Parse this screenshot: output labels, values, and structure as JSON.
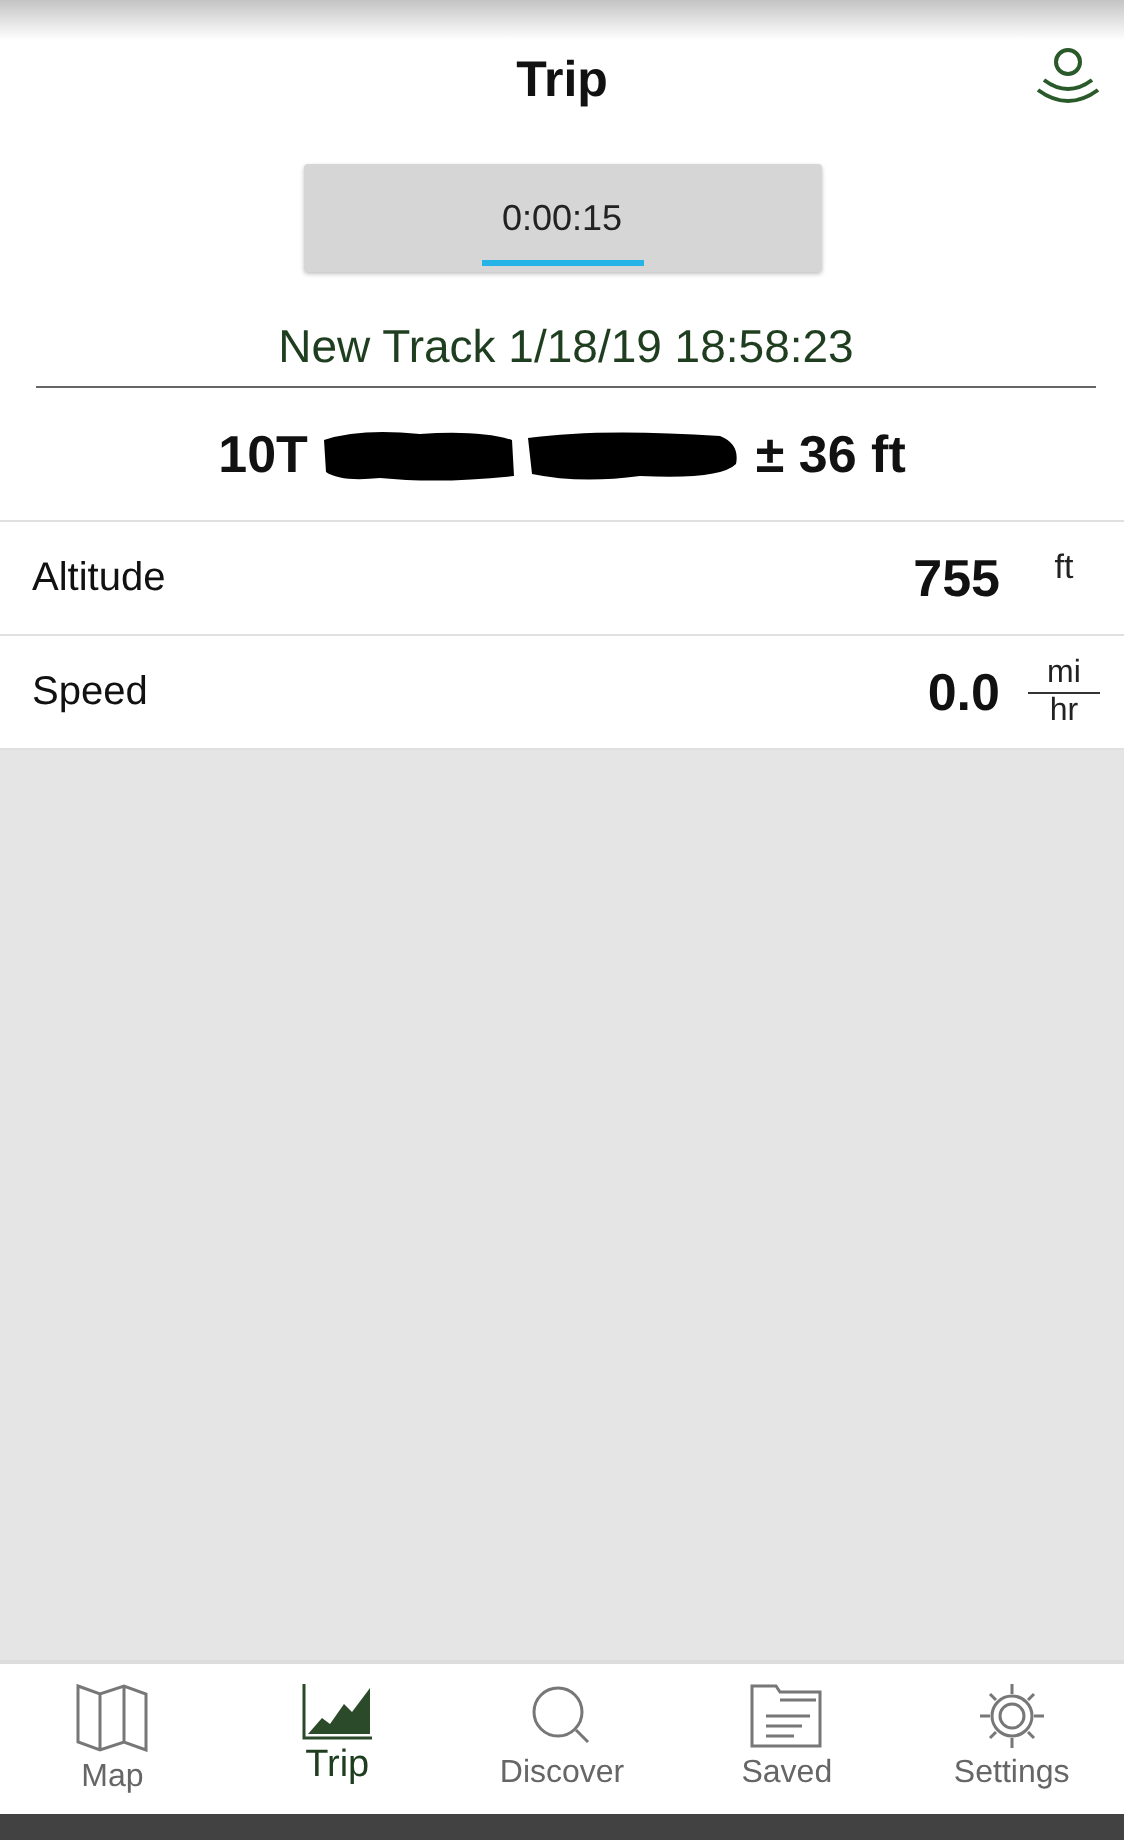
{
  "header": {
    "title": "Trip"
  },
  "timer": {
    "value": "0:00:15"
  },
  "track": {
    "name": "New Track 1/18/19 18:58:23"
  },
  "position": {
    "zone": "10T",
    "accuracy": "± 36 ft"
  },
  "readings": [
    {
      "kind": "single",
      "label": "Altitude",
      "value": "755",
      "unit": "ft"
    },
    {
      "kind": "fraction",
      "label": "Speed",
      "value": "0.0",
      "unit_top": "mi",
      "unit_bottom": "hr"
    }
  ],
  "tabs": [
    {
      "label": "Map",
      "selected": false
    },
    {
      "label": "Trip",
      "selected": true
    },
    {
      "label": "Discover",
      "selected": false
    },
    {
      "label": "Saved",
      "selected": false
    },
    {
      "label": "Settings",
      "selected": false
    }
  ]
}
